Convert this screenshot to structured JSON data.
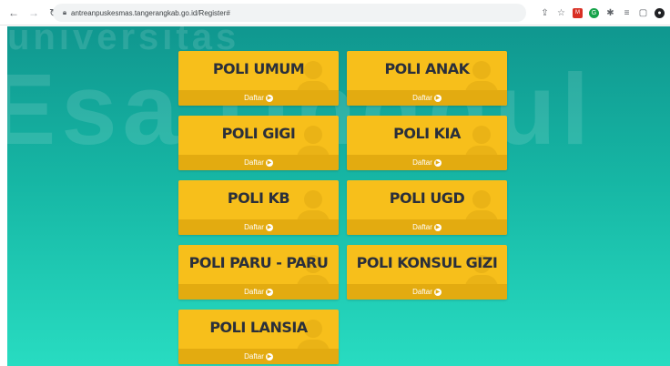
{
  "browser": {
    "url": "antreanpuskesmas.tangerangkab.go.id/Register#",
    "extension_icons": [
      "share-icon",
      "star-icon",
      "mail-ext-icon",
      "grammar-ext-icon",
      "puzzle-icon",
      "reading-list-icon",
      "window-icon",
      "profile-avatar-icon"
    ]
  },
  "watermark": {
    "line1": "universitas",
    "line2": "Esa Unggul"
  },
  "cards": [
    {
      "title": "POLI UMUM",
      "footer": "Daftar"
    },
    {
      "title": "POLI ANAK",
      "footer": "Daftar"
    },
    {
      "title": "POLI GIGI",
      "footer": "Daftar"
    },
    {
      "title": "POLI KIA",
      "footer": "Daftar"
    },
    {
      "title": "POLI KB",
      "footer": "Daftar"
    },
    {
      "title": "POLI UGD",
      "footer": "Daftar"
    },
    {
      "title": "POLI PARU - PARU",
      "footer": "Daftar"
    },
    {
      "title": "POLI KONSUL GIZI",
      "footer": "Daftar"
    },
    {
      "title": "POLI LANSIA",
      "footer": "Daftar"
    }
  ],
  "colors": {
    "card": "#f7bf1b",
    "card_footer": "#e3ab10",
    "bg_top": "#10978f",
    "bg_bottom": "#28dcc1"
  }
}
